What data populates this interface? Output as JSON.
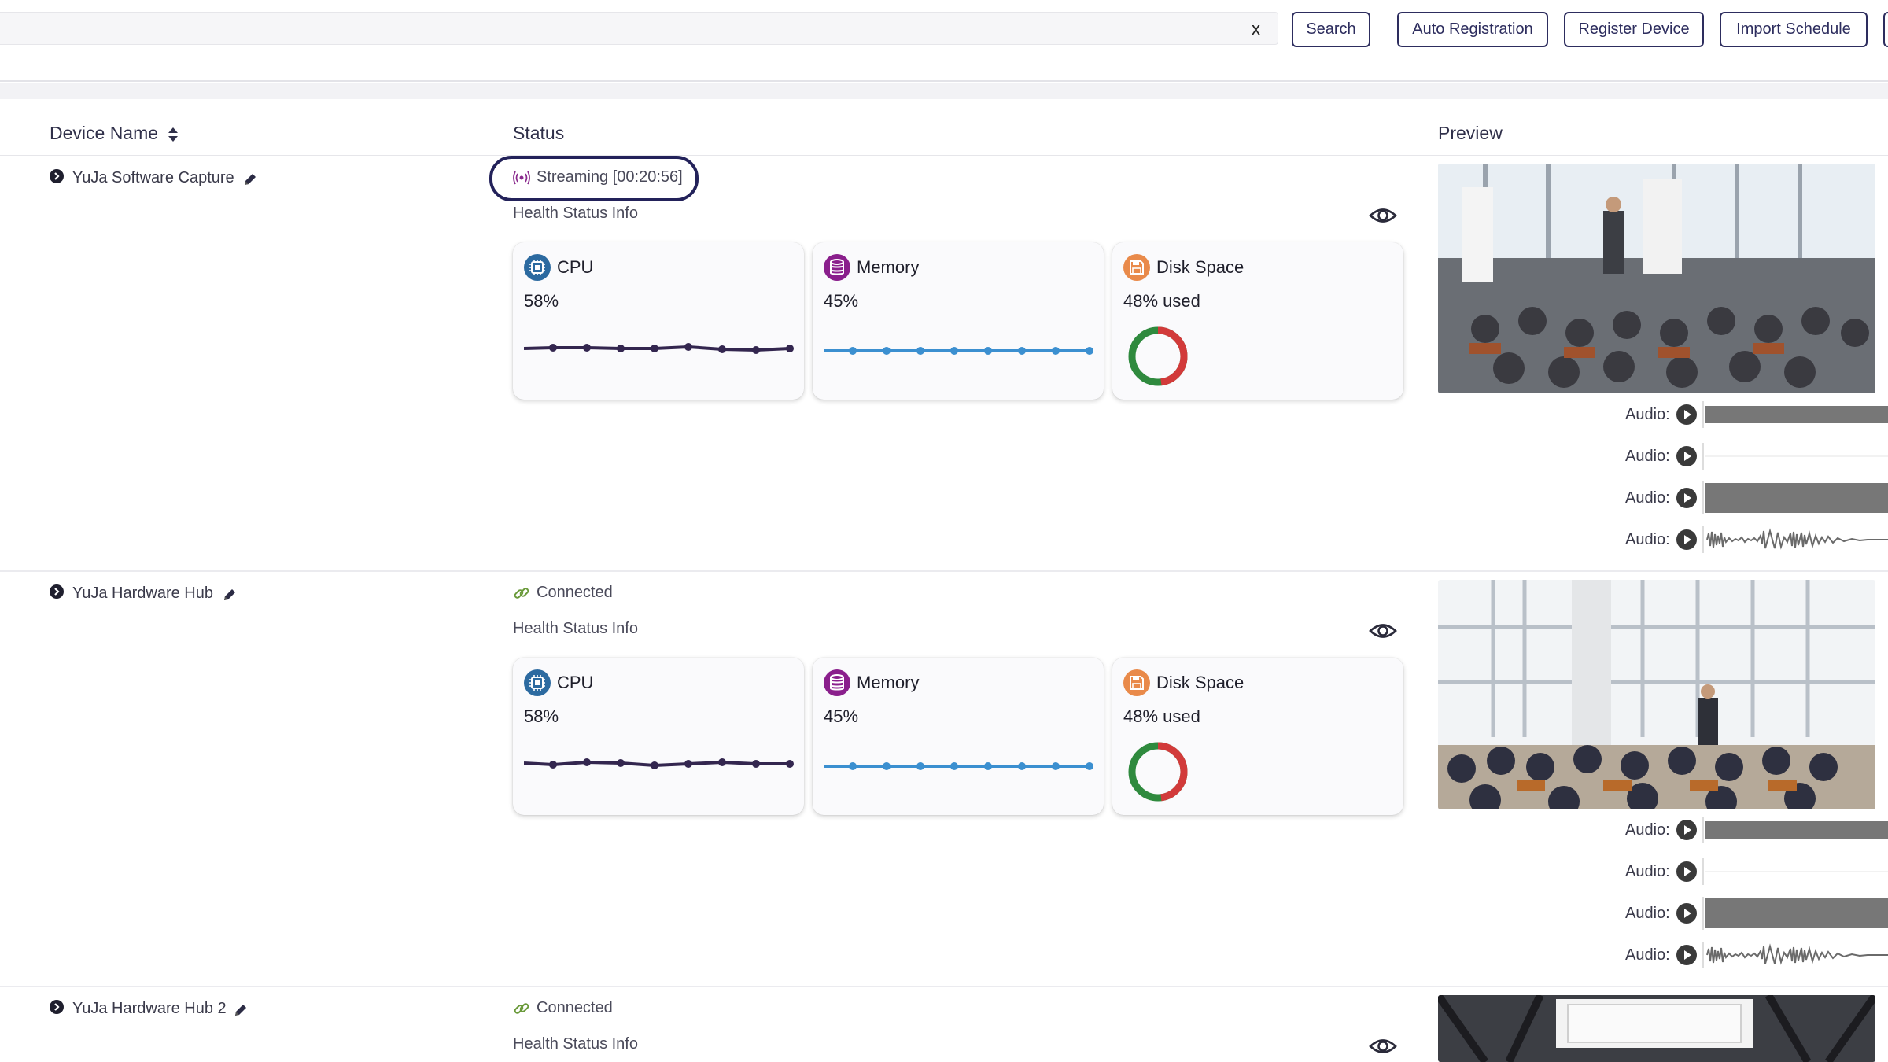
{
  "toolbar": {
    "search_value": "",
    "clear_label": "x",
    "search_label": "Search",
    "auto_registration_label": "Auto Registration",
    "register_device_label": "Register Device",
    "import_schedule_label": "Import Schedule"
  },
  "table": {
    "col_device_name": "Device Name",
    "col_status": "Status",
    "col_preview": "Preview"
  },
  "rows": [
    {
      "name": "YuJa Software Capture",
      "status": "Streaming [00:20:56]",
      "status_kind": "streaming",
      "health_label": "Health Status Info",
      "cpu": {
        "title": "CPU",
        "value": "58%"
      },
      "memory": {
        "title": "Memory",
        "value": "45%"
      },
      "disk": {
        "title": "Disk Space",
        "value": "48% used",
        "used_fraction": 0.48
      },
      "audio": [
        "Audio:",
        "Audio:",
        "Audio:",
        "Audio:"
      ]
    },
    {
      "name": "YuJa Hardware Hub",
      "status": "Connected",
      "status_kind": "connected",
      "health_label": "Health Status Info",
      "cpu": {
        "title": "CPU",
        "value": "58%"
      },
      "memory": {
        "title": "Memory",
        "value": "45%"
      },
      "disk": {
        "title": "Disk Space",
        "value": "48% used",
        "used_fraction": 0.48
      },
      "audio": [
        "Audio:",
        "Audio:",
        "Audio:",
        "Audio:"
      ]
    },
    {
      "name": "YuJa Hardware Hub 2",
      "status": "Connected",
      "status_kind": "connected",
      "health_label": "Health Status Info"
    }
  ],
  "colors": {
    "navy": "#23225a",
    "cpu_icon": "#2c6aa0",
    "memory_icon": "#8a1f8c",
    "disk_icon": "#e98a4a",
    "cpu_line": "#33264f",
    "memory_line": "#3b8fd0",
    "donut_used": "#d23a3a",
    "donut_free": "#2f8a3e",
    "connected": "#6a9a3a",
    "streaming": "#8a2b8e"
  },
  "icons": {
    "expand": "chevron-right-circle-icon",
    "edit": "pencil-icon",
    "streaming": "broadcast-icon",
    "connected": "link-icon",
    "eye": "eye-icon",
    "cpu": "chip-icon",
    "memory": "database-icon",
    "disk": "floppy-disk-icon",
    "play": "play-circle-icon",
    "sort": "sort-icon"
  }
}
